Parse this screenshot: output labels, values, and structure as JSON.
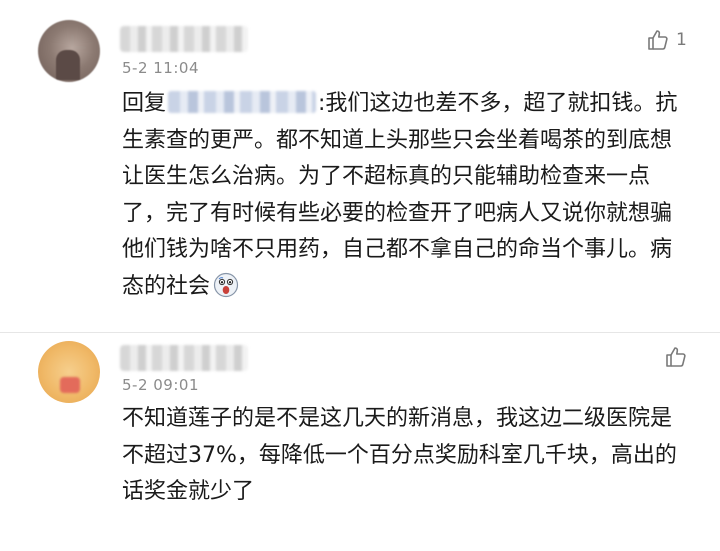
{
  "comments": [
    {
      "time": "5-2 11:04",
      "like_count": "1",
      "reply_prefix": "回复",
      "text": ":我们这边也差不多，超了就扣钱。抗生素查的更严。都不知道上头那些只会坐着喝茶的到底想让医生怎么治病。为了不超标真的只能辅助检查来一点了，完了有时候有些必要的检查开了吧病人又说你就想骗他们钱为啥不只用药，自己都不拿自己的命当个事儿。病态的社会",
      "emoji": "scream-emoji"
    },
    {
      "time": "5-2 09:01",
      "text": "不知道莲子的是不是这几天的新消息，我这边二级医院是不超过37%，每降低一个百分点奖励科室几千块，高出的话奖金就少了"
    }
  ],
  "icons": {
    "like": "thumbs-up-icon"
  },
  "colors": {
    "text": "#1a1a1a",
    "meta": "#8b8b8b",
    "divider": "#e6e6e6"
  }
}
